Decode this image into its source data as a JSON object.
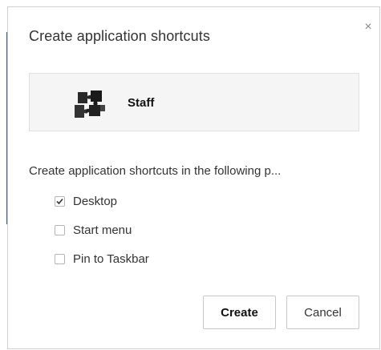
{
  "dialog": {
    "title": "Create application shortcuts",
    "close_label": "×"
  },
  "app": {
    "name": "Staff",
    "icon": "puzzle-app-icon"
  },
  "instruction": "Create application shortcuts in the following p...",
  "options": [
    {
      "label": "Desktop",
      "checked": true
    },
    {
      "label": "Start menu",
      "checked": false
    },
    {
      "label": "Pin to Taskbar",
      "checked": false
    }
  ],
  "buttons": {
    "create_label": "Create",
    "cancel_label": "Cancel"
  },
  "colors": {
    "border": "#d0d0d0",
    "app_box_bg": "#f5f5f5",
    "text": "#333333"
  }
}
